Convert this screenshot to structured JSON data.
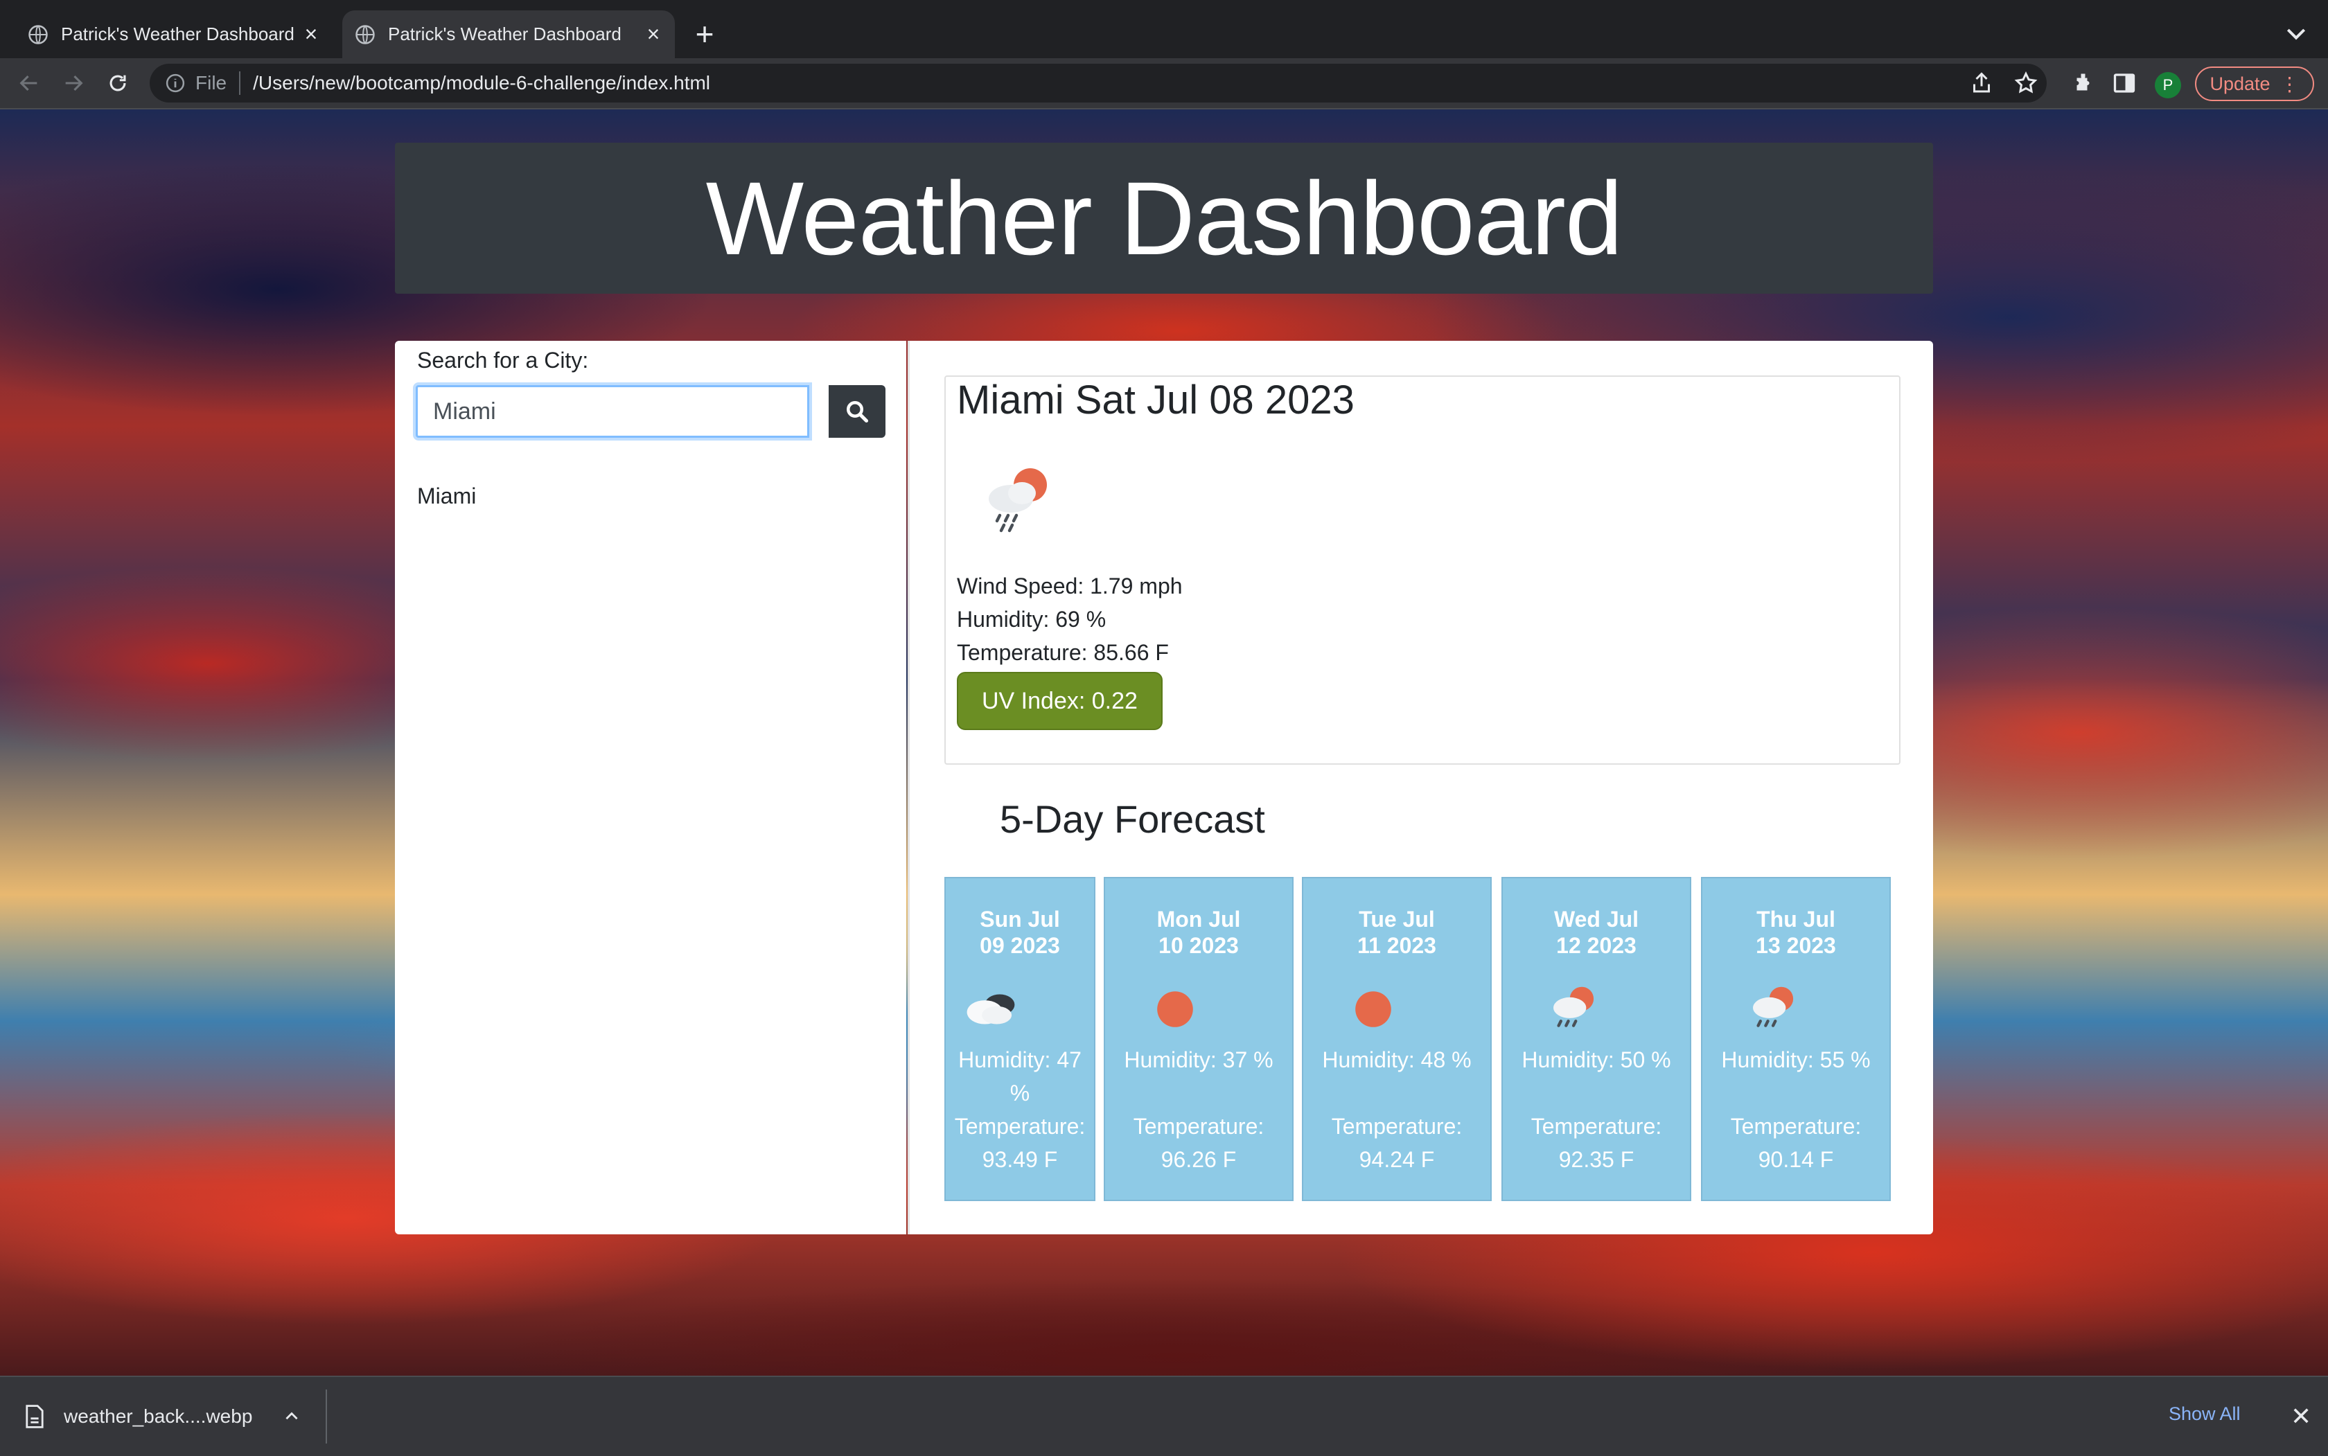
{
  "browser": {
    "tabs": [
      {
        "title": "Patrick's Weather Dashboard",
        "active": false
      },
      {
        "title": "Patrick's Weather Dashboard",
        "active": true
      }
    ],
    "address": {
      "scheme": "File",
      "url": "/Users/new/bootcamp/module-6-challenge/index.html"
    },
    "profile_initial": "P",
    "update_label": "Update"
  },
  "page": {
    "title": "Weather Dashboard",
    "search": {
      "label": "Search for a City:",
      "value": "Miami"
    },
    "history": [
      "Miami"
    ],
    "current": {
      "heading": "Miami Sat Jul 08 2023",
      "icon": "rain-sun-icon",
      "wind": "Wind Speed: 1.79 mph",
      "humidity": "Humidity: 69 %",
      "temperature": "Temperature: 85.66 F",
      "uv": "UV Index: 0.22",
      "uv_color": "#6b8e23"
    },
    "forecast_title": "5-Day Forecast",
    "forecast": [
      {
        "date_line1": "Sun Jul",
        "date_line2": "09 2023",
        "icon": "cloudy-icon",
        "humidity": "Humidity: 47 %",
        "temperature": "Temperature: 93.49 F"
      },
      {
        "date_line1": "Mon Jul",
        "date_line2": "10 2023",
        "icon": "sun-icon",
        "humidity": "Humidity: 37 %",
        "temperature": "Temperature: 96.26 F"
      },
      {
        "date_line1": "Tue Jul",
        "date_line2": "11 2023",
        "icon": "sun-icon",
        "humidity": "Humidity: 48 %",
        "temperature": "Temperature: 94.24 F"
      },
      {
        "date_line1": "Wed Jul",
        "date_line2": "12 2023",
        "icon": "rain-sun-icon",
        "humidity": "Humidity: 50 %",
        "temperature": "Temperature: 92.35 F"
      },
      {
        "date_line1": "Thu Jul",
        "date_line2": "13 2023",
        "icon": "rain-sun-icon",
        "humidity": "Humidity: 55 %",
        "temperature": "Temperature: 90.14 F"
      }
    ],
    "forecast_card_color": "#8ecae6"
  },
  "downloads": {
    "file": "weather_back....webp",
    "show_all": "Show All"
  }
}
